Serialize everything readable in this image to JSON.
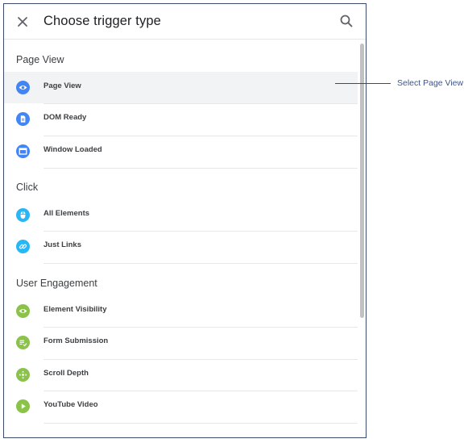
{
  "dialog": {
    "title": "Choose trigger type",
    "close_icon": "close-icon",
    "search_icon": "search-icon"
  },
  "sections": [
    {
      "title": "Page View",
      "items": [
        {
          "label": "Page View",
          "icon": "eye-icon",
          "color": "#4285f4",
          "selected": true
        },
        {
          "label": "DOM Ready",
          "icon": "document-icon",
          "color": "#4285f4"
        },
        {
          "label": "Window Loaded",
          "icon": "window-icon",
          "color": "#4285f4"
        }
      ]
    },
    {
      "title": "Click",
      "items": [
        {
          "label": "All Elements",
          "icon": "mouse-icon",
          "color": "#29b6f6"
        },
        {
          "label": "Just Links",
          "icon": "link-icon",
          "color": "#29b6f6"
        }
      ]
    },
    {
      "title": "User Engagement",
      "items": [
        {
          "label": "Element Visibility",
          "icon": "eye-icon",
          "color": "#8bc34a"
        },
        {
          "label": "Form Submission",
          "icon": "form-icon",
          "color": "#8bc34a"
        },
        {
          "label": "Scroll Depth",
          "icon": "move-icon",
          "color": "#8bc34a"
        },
        {
          "label": "YouTube Video",
          "icon": "play-icon",
          "color": "#8bc34a"
        }
      ]
    }
  ],
  "callout": {
    "text": "Select Page View"
  }
}
